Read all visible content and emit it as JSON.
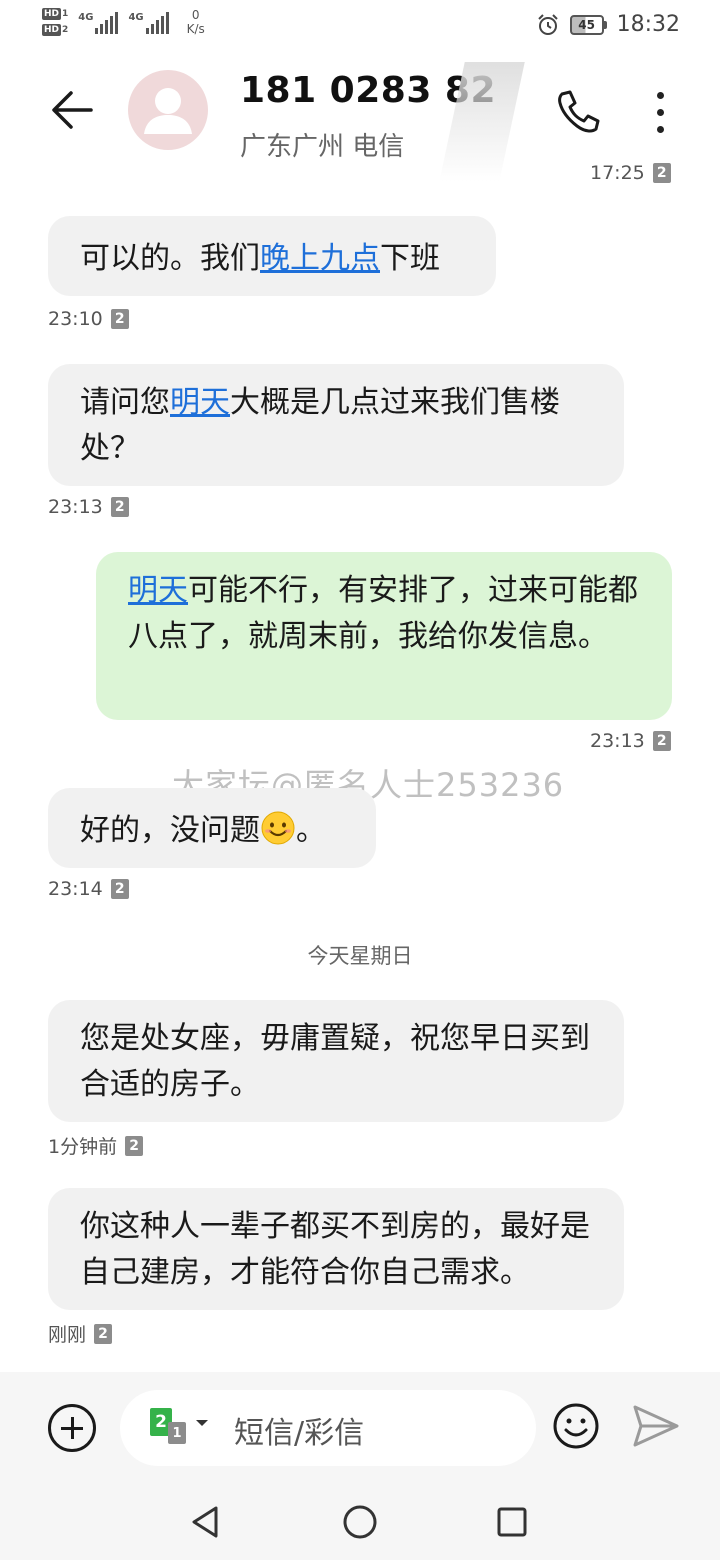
{
  "status_bar": {
    "sim1_label": "HD",
    "sim1_num": "1",
    "sim2_label": "HD",
    "sim2_num": "2",
    "net1": "4G",
    "net2": "4G",
    "speed_value": "0",
    "speed_unit": "K/s",
    "battery": "45",
    "time": "18:32",
    "icons": [
      "alarm-icon",
      "battery-icon"
    ]
  },
  "header": {
    "contact_number": "181 0283 82",
    "location": "广东广州 电信",
    "icons": [
      "back-arrow-icon",
      "avatar",
      "call-icon",
      "more-icon"
    ]
  },
  "messages": {
    "top_partial_time": "17:25",
    "sim_badge": "2",
    "watermark": "大家坛@匿名人士253236",
    "m1": {
      "before": "可以的。我们",
      "link": "晚上九点",
      "after": "下班",
      "time": "23:10"
    },
    "m2": {
      "before": "请问您",
      "link": "明天",
      "after": "大概是几点过来我们售楼处？",
      "time": "23:13"
    },
    "m3": {
      "link": "明天",
      "after": "可能不行，有安排了，过来可能都八点了，就周末前，我给你发信息。",
      "time": "23:13"
    },
    "m4": {
      "before": "好的，没问题",
      "after": "。",
      "time": "23:14"
    },
    "date_separator": "今天星期日",
    "m5": {
      "text": "您是处女座，毋庸置疑，祝您早日买到合适的房子。",
      "time": "1分钟前"
    },
    "m6": {
      "text": "你这种人一辈子都买不到房的，最好是自己建房，才能符合你自己需求。",
      "time": "刚刚"
    }
  },
  "composer": {
    "sim_primary": "2",
    "sim_secondary": "1",
    "placeholder": "短信/彩信",
    "icons": [
      "add-icon",
      "emoji-icon",
      "send-icon"
    ]
  },
  "nav": {
    "icons": [
      "nav-back-icon",
      "nav-home-icon",
      "nav-recents-icon"
    ]
  },
  "colors": {
    "incoming_bubble": "#f1f1f1",
    "outgoing_bubble": "#dcf5d6",
    "link": "#1e6fd9",
    "sim_badge": "#8c8c8c",
    "sim_active": "#35b24a"
  }
}
